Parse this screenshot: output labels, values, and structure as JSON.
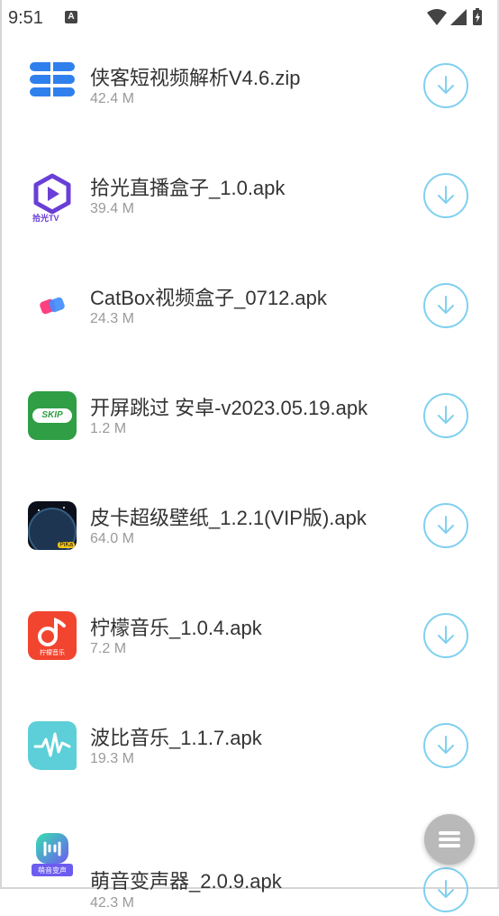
{
  "status_bar": {
    "time": "9:51",
    "notification_badge": "A"
  },
  "downloads": [
    {
      "name": "侠客短视频解析V4.6.zip",
      "size": "42.4 M",
      "icon": "blue-stack-icon"
    },
    {
      "name": "拾光直播盒子_1.0.apk",
      "size": "39.4 M",
      "icon": "shiguang-tv-icon",
      "icon_caption": "拾光TV"
    },
    {
      "name": "CatBox视频盒子_0712.apk",
      "size": "24.3 M",
      "icon": "catbox-icon"
    },
    {
      "name": "开屏跳过 安卓-v2023.05.19.apk",
      "size": "1.2 M",
      "icon": "skip-icon",
      "icon_caption": "SKIP"
    },
    {
      "name": "皮卡超级壁纸_1.2.1(VIP版).apk",
      "size": "64.0 M",
      "icon": "pika-wallpaper-icon",
      "icon_caption": "PiKa"
    },
    {
      "name": "柠檬音乐_1.0.4.apk",
      "size": "7.2 M",
      "icon": "lemon-music-icon",
      "icon_caption": "柠檬音乐"
    },
    {
      "name": "波比音乐_1.1.7.apk",
      "size": "19.3 M",
      "icon": "bobi-music-icon"
    },
    {
      "name": "萌音变声器_2.0.9.apk",
      "size": "42.3 M",
      "icon": "mengyin-voice-icon",
      "icon_caption": "萌音变声"
    }
  ],
  "colors": {
    "download_ring": "#7fd0f0",
    "title": "#333333",
    "size": "#9a9a9a",
    "fab": "#b9b9b9"
  }
}
